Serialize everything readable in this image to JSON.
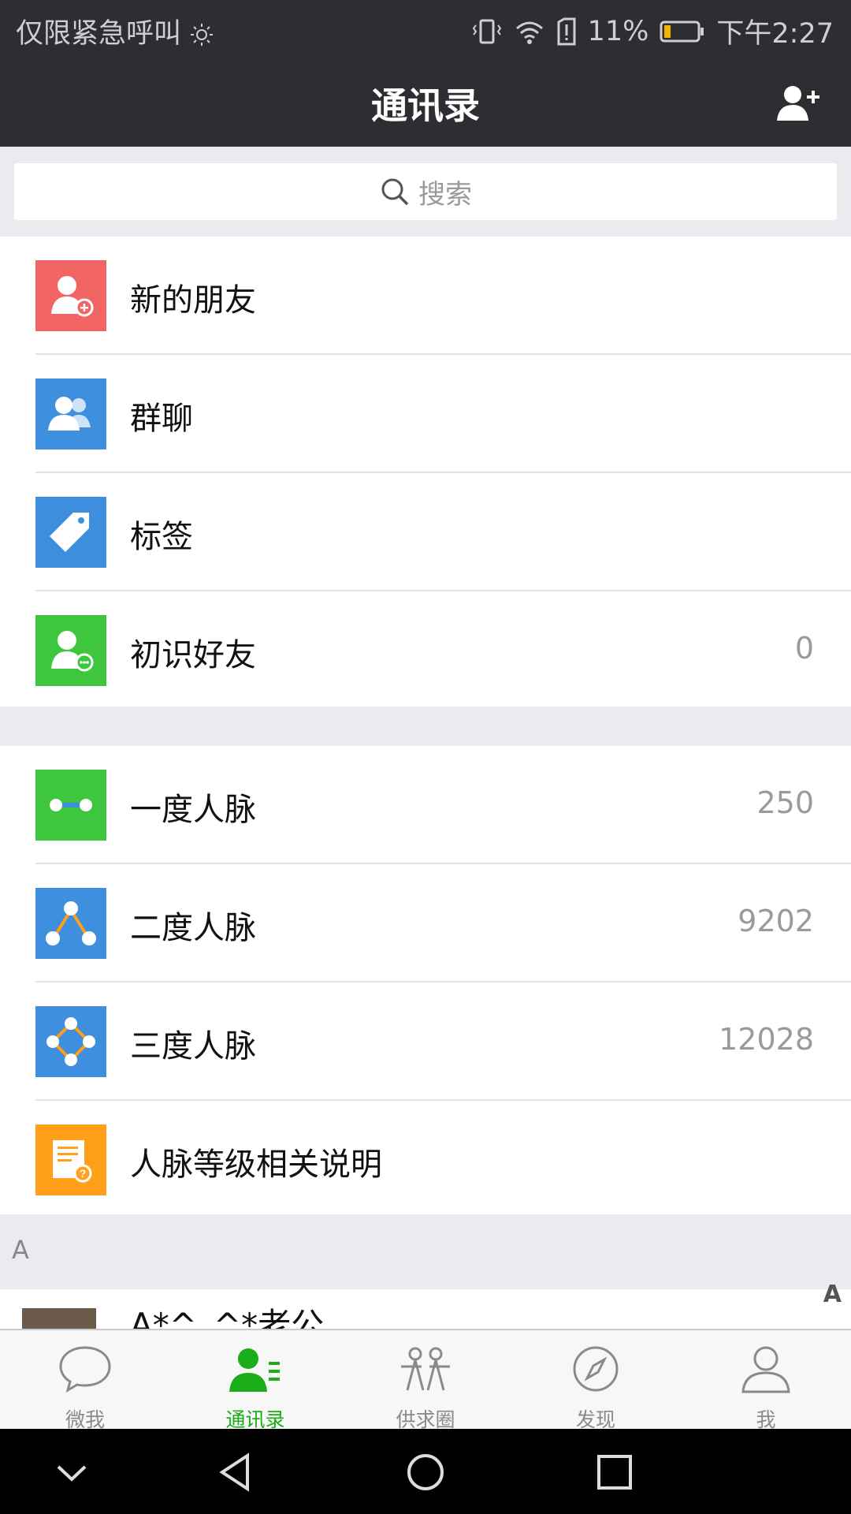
{
  "status_bar": {
    "left_text": "仅限紧急呼叫",
    "battery": "11%",
    "time": "下午2:27"
  },
  "header": {
    "title": "通讯录"
  },
  "search": {
    "placeholder": "搜索"
  },
  "menu_group_1": [
    {
      "label": "新的朋友",
      "icon": "new-friends-icon",
      "color": "#f26565",
      "count": ""
    },
    {
      "label": "群聊",
      "icon": "group-chat-icon",
      "color": "#3f8fdf",
      "count": ""
    },
    {
      "label": "标签",
      "icon": "tag-icon",
      "color": "#3f8fdf",
      "count": ""
    },
    {
      "label": "初识好友",
      "icon": "acquaintance-icon",
      "color": "#3fc63f",
      "count": "0"
    }
  ],
  "menu_group_2": [
    {
      "label": "一度人脉",
      "icon": "first-degree-icon",
      "color": "#3fc63f",
      "count": "250"
    },
    {
      "label": "二度人脉",
      "icon": "second-degree-icon",
      "color": "#3f8fdf",
      "count": "9202"
    },
    {
      "label": "三度人脉",
      "icon": "third-degree-icon",
      "color": "#3f8fdf",
      "count": "12028"
    },
    {
      "label": "人脉等级相关说明",
      "icon": "document-help-icon",
      "color": "#ff9f1a",
      "count": ""
    }
  ],
  "contacts": {
    "section_letter": "A",
    "first_name": "A*^_^*老公",
    "index_letter": "A"
  },
  "tabs": [
    {
      "label": "微我",
      "icon": "chat-bubble-icon",
      "active": false
    },
    {
      "label": "通讯录",
      "icon": "contacts-icon",
      "active": true
    },
    {
      "label": "供求圈",
      "icon": "people-circle-icon",
      "active": false
    },
    {
      "label": "发现",
      "icon": "compass-icon",
      "active": false
    },
    {
      "label": "我",
      "icon": "profile-icon",
      "active": false
    }
  ],
  "colors": {
    "header_bg": "#2d2d32",
    "active_tab": "#1aad19"
  }
}
